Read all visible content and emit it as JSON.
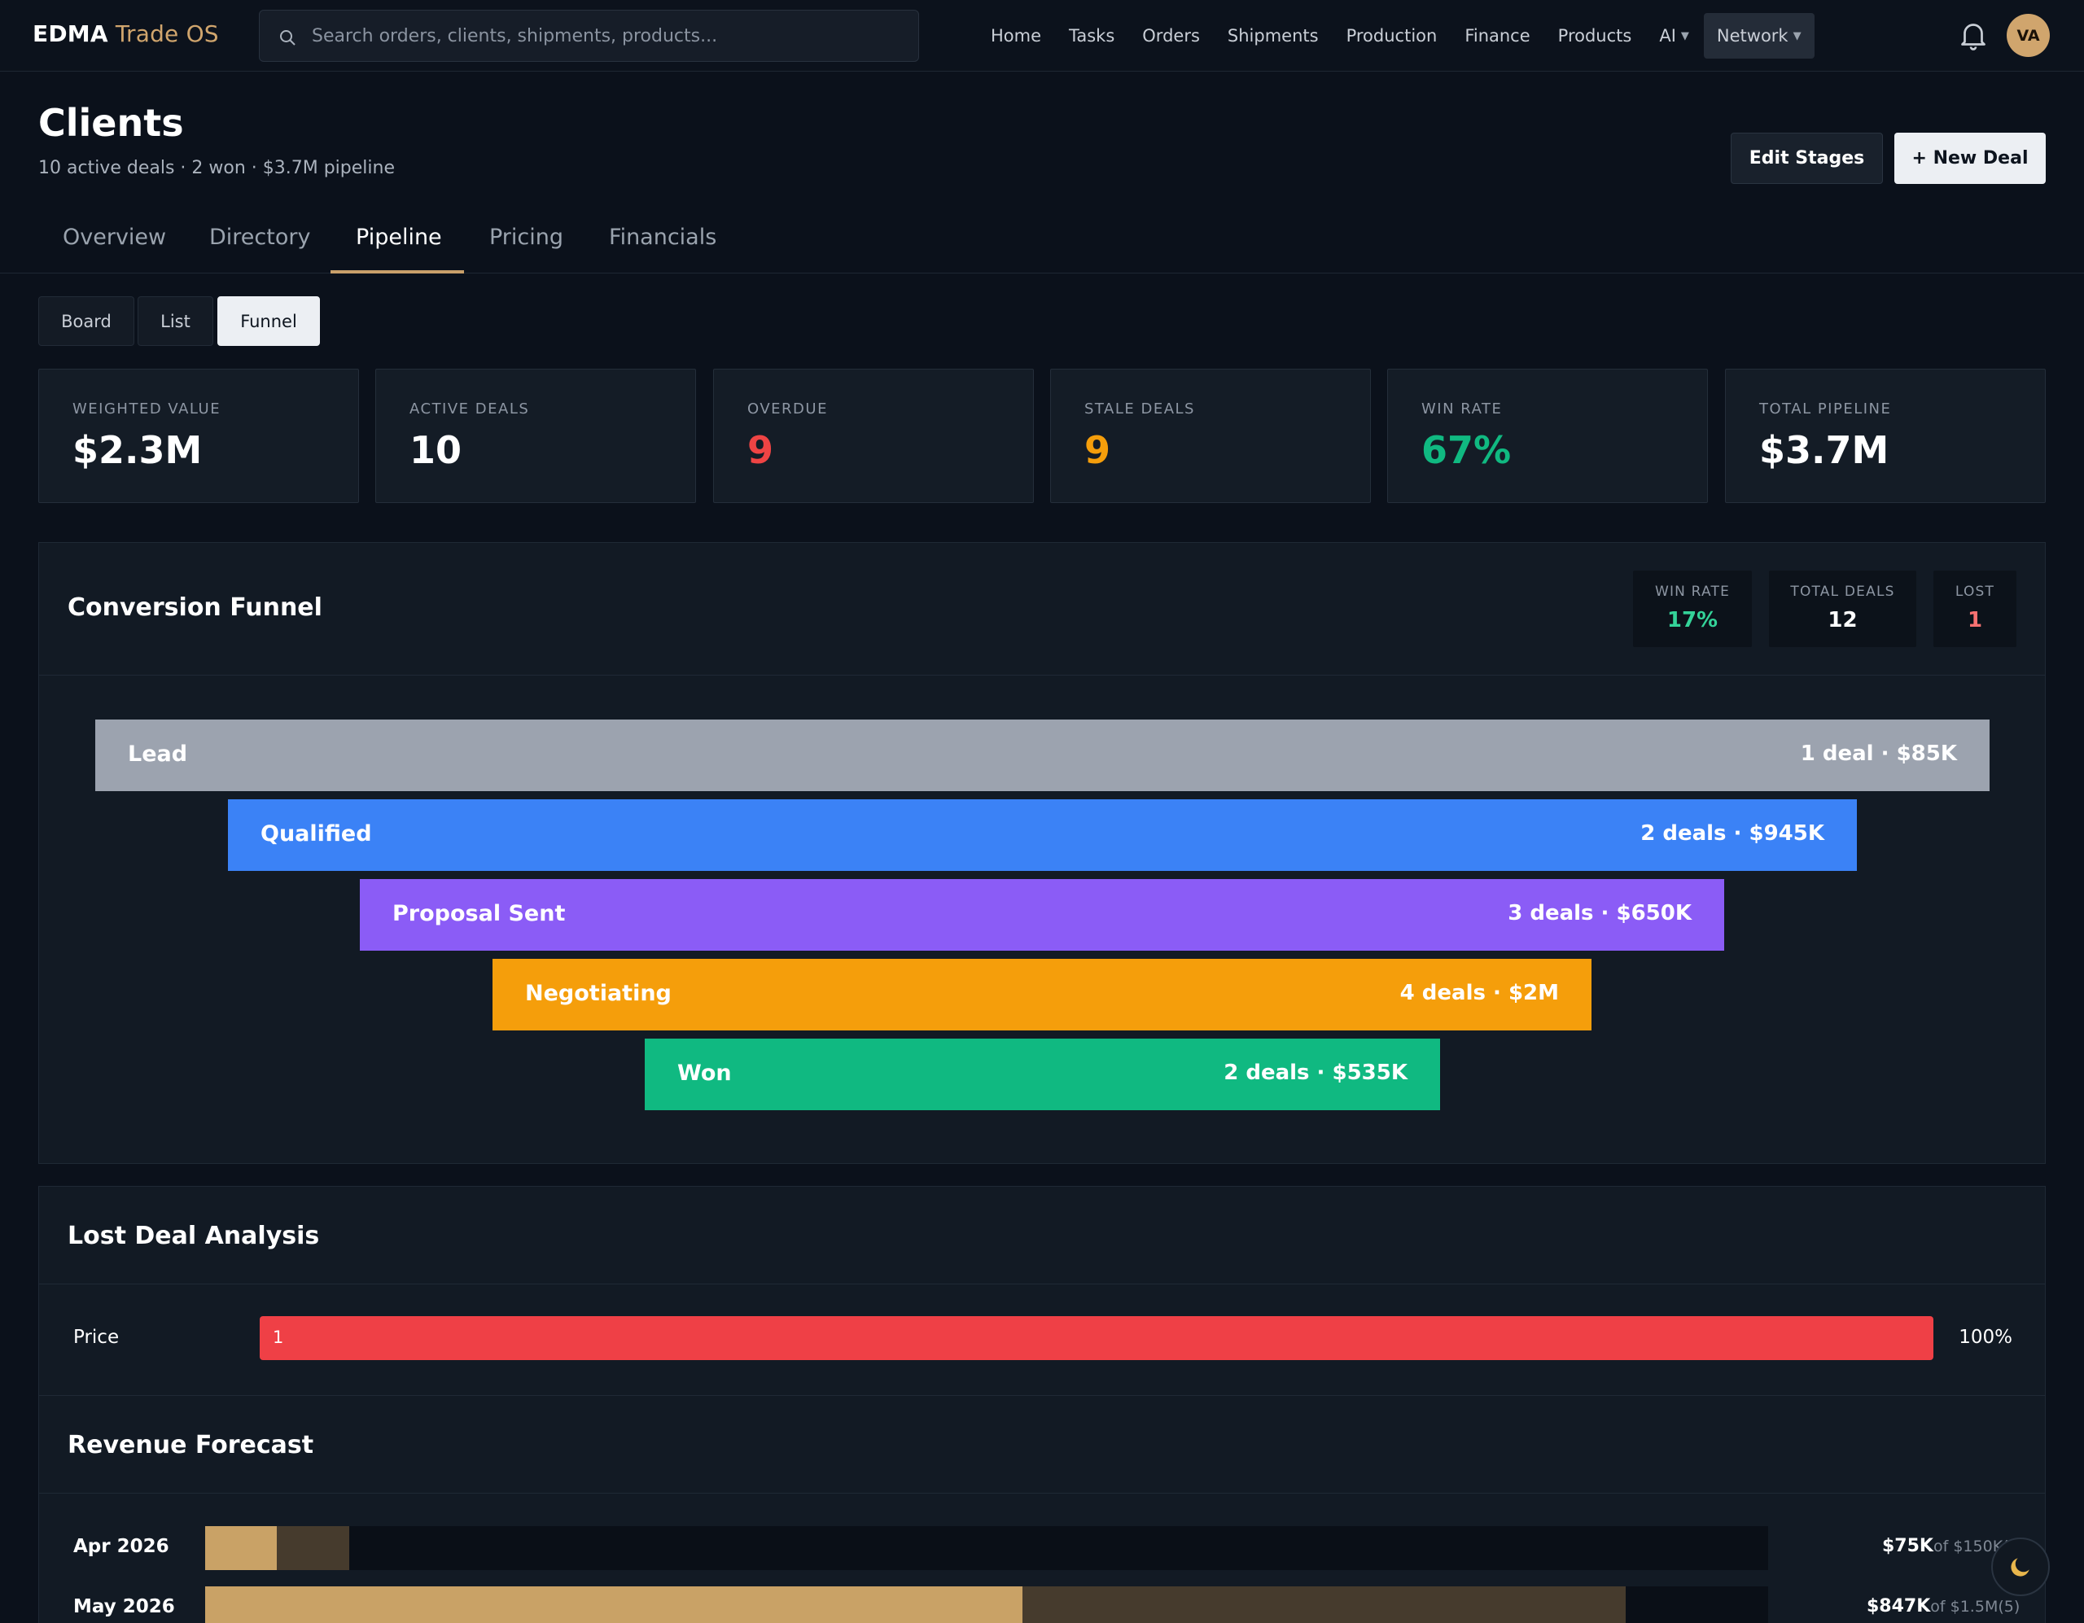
{
  "nav": {
    "brand_primary": "EDMA",
    "brand_secondary": "Trade OS",
    "search_placeholder": "Search orders, clients, shipments, products...",
    "links": [
      "Home",
      "Tasks",
      "Orders",
      "Shipments",
      "Production",
      "Finance",
      "Products"
    ],
    "ai_label": "AI",
    "network_label": "Network",
    "avatar_initials": "VA"
  },
  "header": {
    "title": "Clients",
    "subtitle": "10 active deals · 2 won · $3.7M pipeline",
    "edit_stages_label": "Edit Stages",
    "new_deal_label": "+ New Deal"
  },
  "tabs": [
    "Overview",
    "Directory",
    "Pipeline",
    "Pricing",
    "Financials"
  ],
  "active_tab": "Pipeline",
  "views": [
    "Board",
    "List",
    "Funnel"
  ],
  "active_view": "Funnel",
  "kpis": [
    {
      "label": "WEIGHTED VALUE",
      "value": "$2.3M",
      "color": "#ffffff"
    },
    {
      "label": "ACTIVE DEALS",
      "value": "10",
      "color": "#ffffff"
    },
    {
      "label": "OVERDUE",
      "value": "9",
      "color": "#ef4444"
    },
    {
      "label": "STALE DEALS",
      "value": "9",
      "color": "#f59e0b"
    },
    {
      "label": "WIN RATE",
      "value": "67%",
      "color": "#10b981"
    },
    {
      "label": "TOTAL PIPELINE",
      "value": "$3.7M",
      "color": "#ffffff"
    }
  ],
  "funnel": {
    "title": "Conversion Funnel",
    "stats": [
      {
        "label": "WIN RATE",
        "value": "17%",
        "color": "#34d399"
      },
      {
        "label": "TOTAL DEALS",
        "value": "12",
        "color": "#ffffff"
      },
      {
        "label": "LOST",
        "value": "1",
        "color": "#f87171"
      }
    ],
    "stages": [
      {
        "name": "Lead",
        "meta": "1 deal · $85K",
        "color": "#9ca3af"
      },
      {
        "name": "Qualified",
        "meta": "2 deals · $945K",
        "color": "#3b82f6"
      },
      {
        "name": "Proposal Sent",
        "meta": "3 deals · $650K",
        "color": "#8b5cf6"
      },
      {
        "name": "Negotiating",
        "meta": "4 deals · $2M",
        "color": "#f59e0b"
      },
      {
        "name": "Won",
        "meta": "2 deals · $535K",
        "color": "#10b981"
      }
    ]
  },
  "lost_analysis": {
    "title": "Lost Deal Analysis",
    "rows": [
      {
        "reason": "Price",
        "count": "1",
        "percent": "100%",
        "fraction": 1.0
      }
    ]
  },
  "forecast": {
    "title": "Revenue Forecast",
    "rows": [
      {
        "month": "Apr 2026",
        "value": "$75K",
        "of_text": "of $150K(",
        "weighted_fraction": 0.046,
        "total_fraction": 0.092
      },
      {
        "month": "May 2026",
        "value": "$847K",
        "of_text": "of $1.5M(5)",
        "weighted_fraction": 0.523,
        "total_fraction": 0.909
      }
    ]
  },
  "theme_toggle_icon": "moon-icon"
}
